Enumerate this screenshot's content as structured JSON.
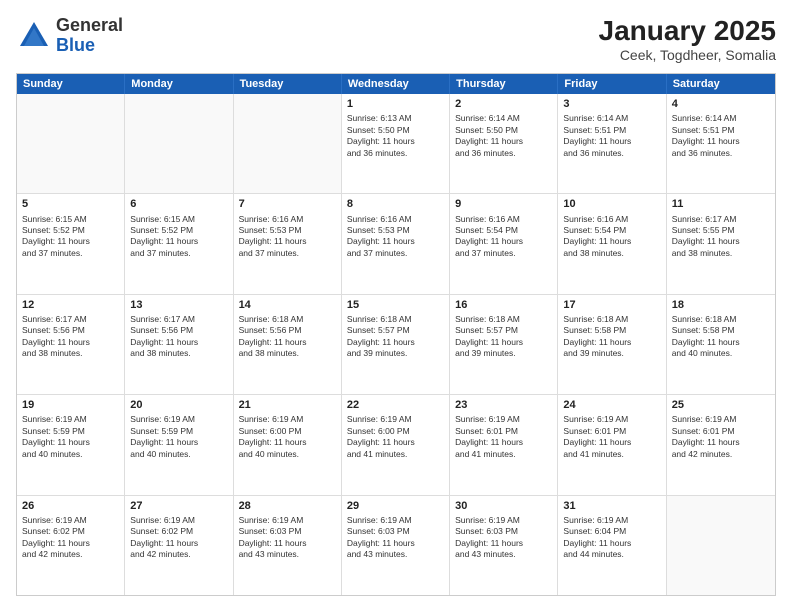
{
  "header": {
    "logo_general": "General",
    "logo_blue": "Blue",
    "title": "January 2025",
    "subtitle": "Ceek, Togdheer, Somalia"
  },
  "calendar": {
    "days_of_week": [
      "Sunday",
      "Monday",
      "Tuesday",
      "Wednesday",
      "Thursday",
      "Friday",
      "Saturday"
    ],
    "weeks": [
      [
        {
          "day": "",
          "info": ""
        },
        {
          "day": "",
          "info": ""
        },
        {
          "day": "",
          "info": ""
        },
        {
          "day": "1",
          "info": "Sunrise: 6:13 AM\nSunset: 5:50 PM\nDaylight: 11 hours\nand 36 minutes."
        },
        {
          "day": "2",
          "info": "Sunrise: 6:14 AM\nSunset: 5:50 PM\nDaylight: 11 hours\nand 36 minutes."
        },
        {
          "day": "3",
          "info": "Sunrise: 6:14 AM\nSunset: 5:51 PM\nDaylight: 11 hours\nand 36 minutes."
        },
        {
          "day": "4",
          "info": "Sunrise: 6:14 AM\nSunset: 5:51 PM\nDaylight: 11 hours\nand 36 minutes."
        }
      ],
      [
        {
          "day": "5",
          "info": "Sunrise: 6:15 AM\nSunset: 5:52 PM\nDaylight: 11 hours\nand 37 minutes."
        },
        {
          "day": "6",
          "info": "Sunrise: 6:15 AM\nSunset: 5:52 PM\nDaylight: 11 hours\nand 37 minutes."
        },
        {
          "day": "7",
          "info": "Sunrise: 6:16 AM\nSunset: 5:53 PM\nDaylight: 11 hours\nand 37 minutes."
        },
        {
          "day": "8",
          "info": "Sunrise: 6:16 AM\nSunset: 5:53 PM\nDaylight: 11 hours\nand 37 minutes."
        },
        {
          "day": "9",
          "info": "Sunrise: 6:16 AM\nSunset: 5:54 PM\nDaylight: 11 hours\nand 37 minutes."
        },
        {
          "day": "10",
          "info": "Sunrise: 6:16 AM\nSunset: 5:54 PM\nDaylight: 11 hours\nand 38 minutes."
        },
        {
          "day": "11",
          "info": "Sunrise: 6:17 AM\nSunset: 5:55 PM\nDaylight: 11 hours\nand 38 minutes."
        }
      ],
      [
        {
          "day": "12",
          "info": "Sunrise: 6:17 AM\nSunset: 5:56 PM\nDaylight: 11 hours\nand 38 minutes."
        },
        {
          "day": "13",
          "info": "Sunrise: 6:17 AM\nSunset: 5:56 PM\nDaylight: 11 hours\nand 38 minutes."
        },
        {
          "day": "14",
          "info": "Sunrise: 6:18 AM\nSunset: 5:56 PM\nDaylight: 11 hours\nand 38 minutes."
        },
        {
          "day": "15",
          "info": "Sunrise: 6:18 AM\nSunset: 5:57 PM\nDaylight: 11 hours\nand 39 minutes."
        },
        {
          "day": "16",
          "info": "Sunrise: 6:18 AM\nSunset: 5:57 PM\nDaylight: 11 hours\nand 39 minutes."
        },
        {
          "day": "17",
          "info": "Sunrise: 6:18 AM\nSunset: 5:58 PM\nDaylight: 11 hours\nand 39 minutes."
        },
        {
          "day": "18",
          "info": "Sunrise: 6:18 AM\nSunset: 5:58 PM\nDaylight: 11 hours\nand 40 minutes."
        }
      ],
      [
        {
          "day": "19",
          "info": "Sunrise: 6:19 AM\nSunset: 5:59 PM\nDaylight: 11 hours\nand 40 minutes."
        },
        {
          "day": "20",
          "info": "Sunrise: 6:19 AM\nSunset: 5:59 PM\nDaylight: 11 hours\nand 40 minutes."
        },
        {
          "day": "21",
          "info": "Sunrise: 6:19 AM\nSunset: 6:00 PM\nDaylight: 11 hours\nand 40 minutes."
        },
        {
          "day": "22",
          "info": "Sunrise: 6:19 AM\nSunset: 6:00 PM\nDaylight: 11 hours\nand 41 minutes."
        },
        {
          "day": "23",
          "info": "Sunrise: 6:19 AM\nSunset: 6:01 PM\nDaylight: 11 hours\nand 41 minutes."
        },
        {
          "day": "24",
          "info": "Sunrise: 6:19 AM\nSunset: 6:01 PM\nDaylight: 11 hours\nand 41 minutes."
        },
        {
          "day": "25",
          "info": "Sunrise: 6:19 AM\nSunset: 6:01 PM\nDaylight: 11 hours\nand 42 minutes."
        }
      ],
      [
        {
          "day": "26",
          "info": "Sunrise: 6:19 AM\nSunset: 6:02 PM\nDaylight: 11 hours\nand 42 minutes."
        },
        {
          "day": "27",
          "info": "Sunrise: 6:19 AM\nSunset: 6:02 PM\nDaylight: 11 hours\nand 42 minutes."
        },
        {
          "day": "28",
          "info": "Sunrise: 6:19 AM\nSunset: 6:03 PM\nDaylight: 11 hours\nand 43 minutes."
        },
        {
          "day": "29",
          "info": "Sunrise: 6:19 AM\nSunset: 6:03 PM\nDaylight: 11 hours\nand 43 minutes."
        },
        {
          "day": "30",
          "info": "Sunrise: 6:19 AM\nSunset: 6:03 PM\nDaylight: 11 hours\nand 43 minutes."
        },
        {
          "day": "31",
          "info": "Sunrise: 6:19 AM\nSunset: 6:04 PM\nDaylight: 11 hours\nand 44 minutes."
        },
        {
          "day": "",
          "info": ""
        }
      ]
    ]
  }
}
